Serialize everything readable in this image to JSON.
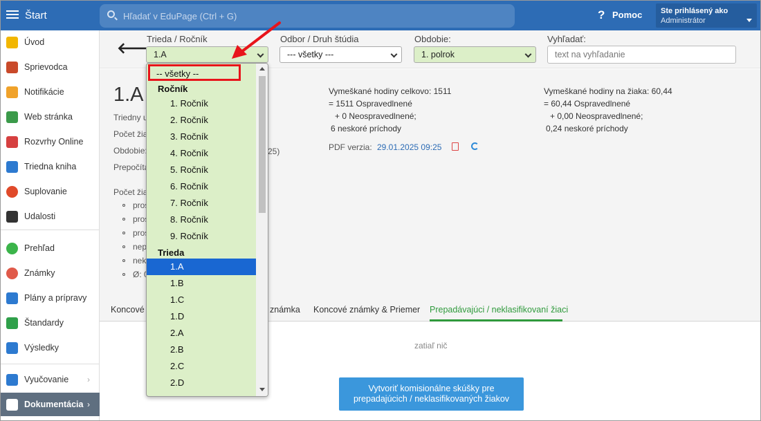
{
  "topbar": {
    "app": "Štart",
    "search_placeholder": "Hľadať v EduPage (Ctrl + G)",
    "help_icon": "?",
    "help_label": "Pomoc",
    "user_line1": "Ste prihlásený ako",
    "user_line2": "Administrátor"
  },
  "sidebar": {
    "items": [
      {
        "label": "Úvod",
        "icon": "star-icon"
      },
      {
        "label": "Sprievodca",
        "icon": "wand-icon"
      },
      {
        "label": "Notifikácie",
        "icon": "envelope-icon"
      },
      {
        "label": "Web stránka",
        "icon": "house-icon"
      },
      {
        "label": "Rozvrhy Online",
        "icon": "calendar-icon"
      },
      {
        "label": "Triedna kniha",
        "icon": "book-icon"
      },
      {
        "label": "Suplovanie",
        "icon": "person-icon"
      },
      {
        "label": "Udalosti",
        "icon": "calendar-dark-icon"
      },
      {
        "label": "Prehľad",
        "icon": "check-circle-icon"
      },
      {
        "label": "Známky",
        "icon": "grade-icon"
      },
      {
        "label": "Plány a prípravy",
        "icon": "briefcase-icon"
      },
      {
        "label": "Štandardy",
        "icon": "shield-icon"
      },
      {
        "label": "Výsledky",
        "icon": "bar-chart-icon"
      },
      {
        "label": "Vyučovanie",
        "icon": "open-book-icon"
      },
      {
        "label": "Dokumentácia",
        "icon": "document-icon"
      }
    ]
  },
  "filters": {
    "class_label": "Trieda / Ročník",
    "class_value": "1.A",
    "field_label": "Odbor / Druh štúdia",
    "field_value": "--- všetky ---",
    "period_label": "Obdobie:",
    "period_value": "1. polrok",
    "search_label": "Vyhľadať:",
    "search_placeholder": "text na vyhľadanie"
  },
  "main": {
    "title": "1.A",
    "meta": [
      "Triedny u",
      "Počet žia",
      "Obdobie:",
      "Prepočíta"
    ],
    "period_tail": "25)",
    "count_label": "Počet žia",
    "bullets": [
      "pros",
      "pros",
      "pros",
      "nep",
      "nek",
      "Ø: 0"
    ],
    "stats_left": {
      "line1": "Vymeškané hodiny celkovo: 1511",
      "line2": "= 1511 Ospravedlnené",
      "line3": "+ 0 Neospravedlnené;",
      "line4": "6 neskoré príchody"
    },
    "stats_right": {
      "line1": "Vymeškané hodiny na žiaka: 60,44",
      "line2": "= 60,44 Ospravedlnené",
      "line3": "+ 0,00 Neospravedlnené;",
      "line4": "0,24 neskoré príchody"
    },
    "pdf_label": "PDF verzia:",
    "pdf_date": "29.01.2025 09:25"
  },
  "tabs": [
    "Koncové z",
    "známka",
    "Koncové známky & Priemer",
    "Prepadávajúci / neklasifikovaní žiaci"
  ],
  "empty_text": "zatiaľ nič",
  "action_button": {
    "line1": "Vytvoriť komisionálne skúšky pre",
    "line2": "prepadajúcich / neklasifikovaných žiakov"
  },
  "dropdown": {
    "all_option": "-- všetky --",
    "group_grade": "Ročník",
    "grades": [
      "1. Ročník",
      "2. Ročník",
      "3. Ročník",
      "4. Ročník",
      "5. Ročník",
      "6. Ročník",
      "7. Ročník",
      "8. Ročník",
      "9. Ročník"
    ],
    "group_class": "Trieda",
    "classes": [
      "1.A",
      "1.B",
      "1.C",
      "1.D",
      "2.A",
      "2.B",
      "2.C",
      "2.D"
    ],
    "selected": "1.A"
  },
  "colors": {
    "topbar": "#2d6cb5",
    "highlight": "#1967d2",
    "annotation": "#e8141b",
    "tab_active": "#2f9a3c",
    "dropdown_bg": "#dcefc8"
  }
}
